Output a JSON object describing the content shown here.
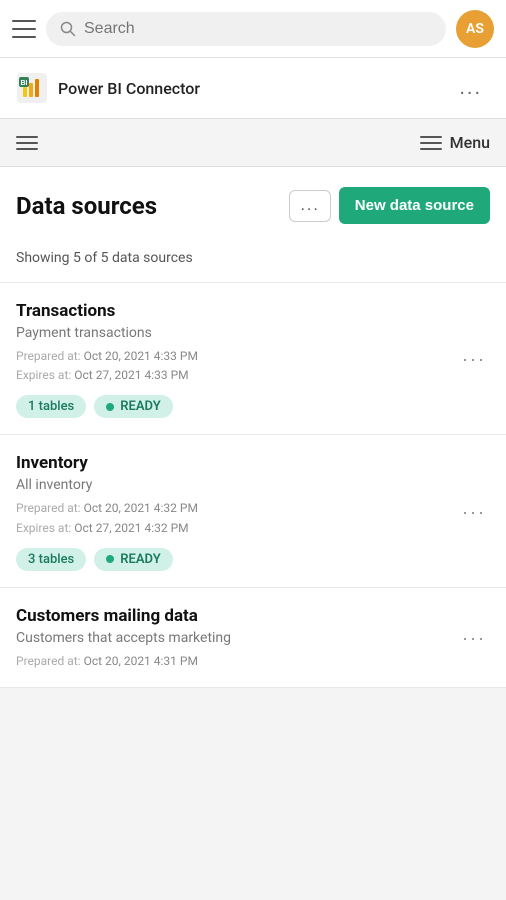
{
  "topbar": {
    "search_placeholder": "Search",
    "avatar_initials": "AS"
  },
  "subnav": {
    "menu_label": "Menu"
  },
  "connector": {
    "name": "Power BI Connector",
    "dots_label": "..."
  },
  "page": {
    "title": "Data sources",
    "more_label": "...",
    "new_datasource_label": "New data source",
    "showing_text": "Showing 5 of 5 data sources"
  },
  "datasources": [
    {
      "name": "Transactions",
      "description": "Payment transactions",
      "prepared_label": "Prepared at:",
      "prepared_value": "Oct 20, 2021 4:33 PM",
      "expires_label": "Expires at:",
      "expires_value": "Oct 27, 2021 4:33 PM",
      "tables_tag": "1 tables",
      "status": "READY"
    },
    {
      "name": "Inventory",
      "description": "All inventory",
      "prepared_label": "Prepared at:",
      "prepared_value": "Oct 20, 2021 4:32 PM",
      "expires_label": "Expires at:",
      "expires_value": "Oct 27, 2021 4:32 PM",
      "tables_tag": "3 tables",
      "status": "READY"
    },
    {
      "name": "Customers mailing data",
      "description": "Customers that accepts marketing",
      "prepared_label": "Prepared at:",
      "prepared_value": "Oct 20, 2021 4:31 PM",
      "expires_label": "",
      "expires_value": "",
      "tables_tag": "",
      "status": ""
    }
  ]
}
